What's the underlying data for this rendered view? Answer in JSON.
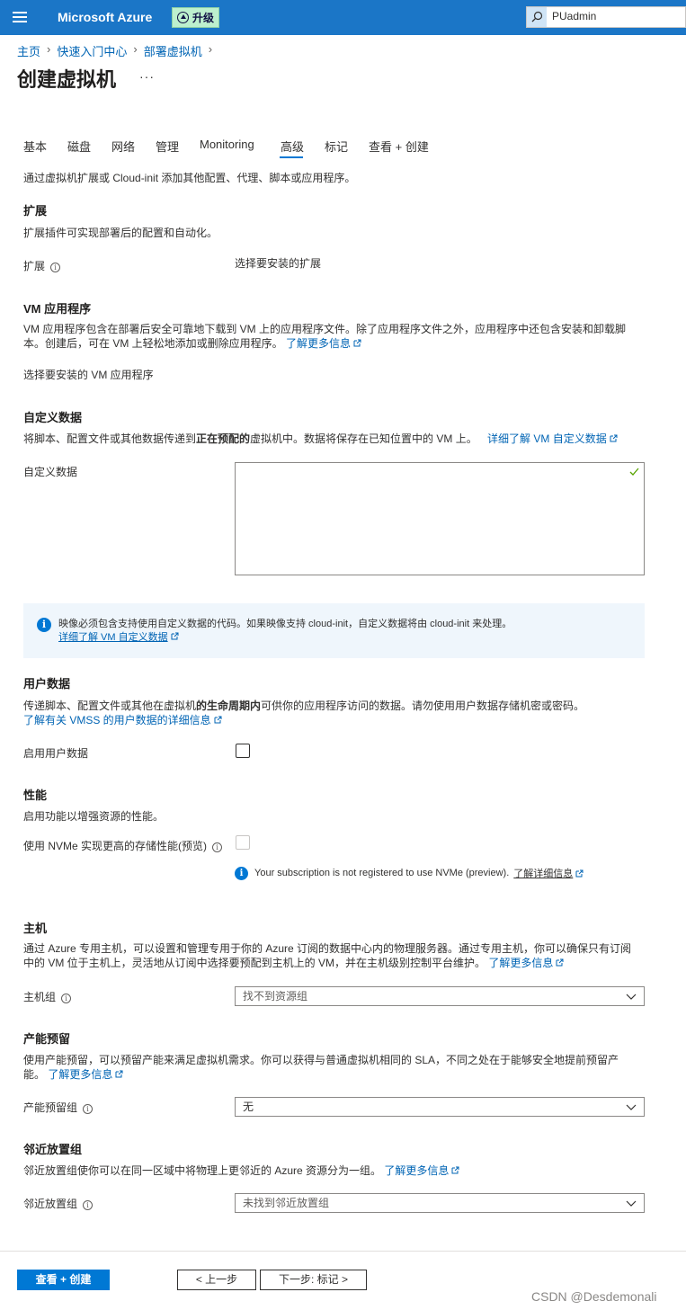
{
  "topbar": {
    "brand": "Microsoft Azure",
    "upgrade_label": "升级",
    "search_value": "PUadmin"
  },
  "breadcrumb": [
    "主页",
    "快速入门中心",
    "部署虚拟机"
  ],
  "page_title": "创建虚拟机",
  "more_label": "···",
  "tabs": [
    {
      "label": "基本",
      "active": false
    },
    {
      "label": "磁盘",
      "active": false
    },
    {
      "label": "网络",
      "active": false
    },
    {
      "label": "管理",
      "active": false
    },
    {
      "label": "Monitoring",
      "active": false
    },
    {
      "label": "高级",
      "active": true
    },
    {
      "label": "标记",
      "active": false
    },
    {
      "label": "查看 + 创建",
      "active": false
    }
  ],
  "intro": "通过虚拟机扩展或 Cloud-init 添加其他配置、代理、脚本或应用程序。",
  "extensions": {
    "heading": "扩展",
    "desc": "扩展插件可实现部署后的配置和自动化。",
    "field_label": "扩展",
    "link": "选择要安装的扩展"
  },
  "vm_apps": {
    "heading": "VM 应用程序",
    "desc_line1": "VM 应用程序包含在部署后安全可靠地下载到 VM 上的应用程序文件。除了应用程序文件之外，应用程序中还包含安装和卸载脚",
    "desc_line2": "本。创建后，可在 VM 上轻松地添加或删除应用程序。",
    "learn_more": "了解更多信息",
    "select_link": "选择要安装的 VM 应用程序"
  },
  "custom_data": {
    "heading": "自定义数据",
    "desc_part1": "将脚本、配置文件或其他数据传递到",
    "desc_bold": "正在预配的",
    "desc_part2": "虚拟机中。数据将保存在已知位置中的 VM 上。",
    "learn_link": "详细了解 VM 自定义数据",
    "field_label": "自定义数据",
    "value": "",
    "info_text": "映像必须包含支持使用自定义数据的代码。如果映像支持 cloud-init，自定义数据将由 cloud-init 来处理。",
    "info_link": "详细了解 VM 自定义数据"
  },
  "user_data": {
    "heading": "用户数据",
    "desc_part1": "传递脚本、配置文件或其他在虚拟机",
    "desc_bold": "的生命周期内",
    "desc_part2": "可供你的应用程序访问的数据。请勿使用用户数据存储机密或密码。",
    "learn_link": "了解有关 VMSS 的用户数据的详细信息",
    "field_label": "启用用户数据"
  },
  "performance": {
    "heading": "性能",
    "desc": "启用功能以增强资源的性能。",
    "field_label": "使用 NVMe 实现更高的存储性能(预览)",
    "notice": "Your subscription is not registered to use NVMe (preview).",
    "notice_link": "了解详细信息"
  },
  "host": {
    "heading": "主机",
    "desc_line1": "通过 Azure 专用主机，可以设置和管理专用于你的 Azure 订阅的数据中心内的物理服务器。通过专用主机，你可以确保只有订阅",
    "desc_line2": "中的 VM 位于主机上，灵活地从订阅中选择要预配到主机上的 VM，并在主机级别控制平台维护。",
    "learn_more": "了解更多信息",
    "field_label": "主机组",
    "select_value": "找不到资源组"
  },
  "capacity": {
    "heading": "产能预留",
    "desc_line1": "使用产能预留，可以预留产能来满足虚拟机需求。你可以获得与普通虚拟机相同的 SLA，不同之处在于能够安全地提前预留产",
    "desc_line2": "能。",
    "learn_more": "了解更多信息",
    "field_label": "产能预留组",
    "select_value": "无"
  },
  "proximity": {
    "heading": "邻近放置组",
    "desc": "邻近放置组使你可以在同一区域中将物理上更邻近的 Azure 资源分为一组。",
    "learn_more": "了解更多信息",
    "field_label": "邻近放置组",
    "select_value": "未找到邻近放置组"
  },
  "footer": {
    "review_create": "查看 + 创建",
    "prev": "< 上一步",
    "next": "下一步: 标记 >"
  },
  "watermark": "CSDN @Desdemonali",
  "colors": {
    "topbar": "#1b76c7",
    "link": "#0064b4",
    "primary": "#0078d4",
    "infobox": "#eff6fc",
    "success": "#57a300"
  }
}
